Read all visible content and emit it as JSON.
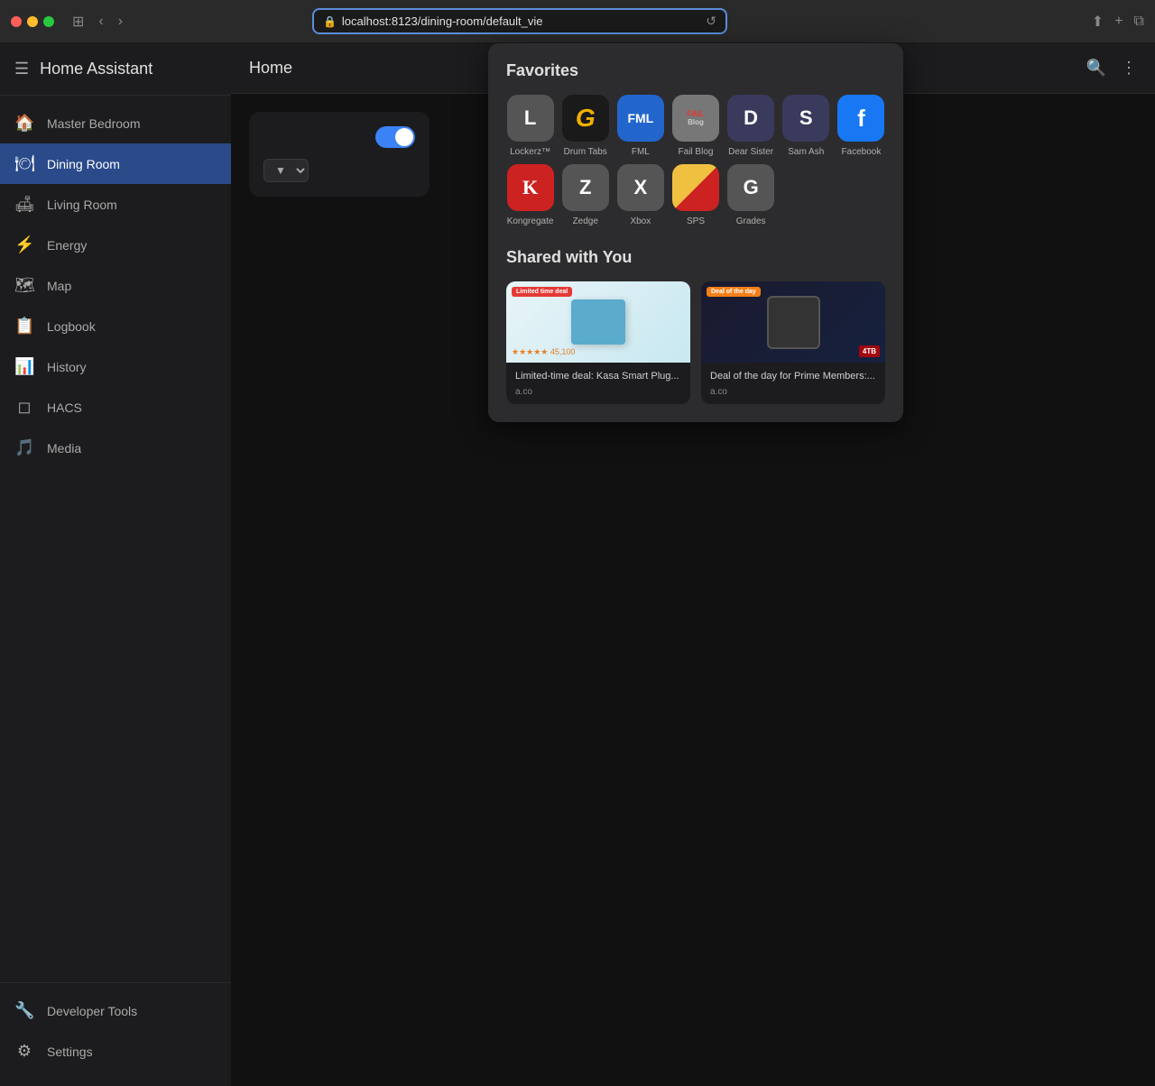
{
  "browser": {
    "url": "localhost:8123/dining-room/default_vie",
    "reload_icon": "↺"
  },
  "app": {
    "title": "Home Assistant",
    "page_title": "Home"
  },
  "sidebar": {
    "items": [
      {
        "id": "master-bedroom",
        "label": "Master Bedroom",
        "icon": "house"
      },
      {
        "id": "dining-room",
        "label": "Dining Room",
        "icon": "dining",
        "active": true
      },
      {
        "id": "living-room",
        "label": "Living Room",
        "icon": "sofa"
      },
      {
        "id": "energy",
        "label": "Energy",
        "icon": "bolt"
      },
      {
        "id": "map",
        "label": "Map",
        "icon": "map"
      },
      {
        "id": "logbook",
        "label": "Logbook",
        "icon": "list"
      },
      {
        "id": "history",
        "label": "History",
        "icon": "chart"
      },
      {
        "id": "hacs",
        "label": "HACS",
        "icon": "hacs"
      },
      {
        "id": "media",
        "label": "Media",
        "icon": "media"
      }
    ],
    "footer_items": [
      {
        "id": "developer-tools",
        "label": "Developer Tools",
        "icon": "wrench"
      },
      {
        "id": "settings",
        "label": "Settings",
        "icon": "gear"
      }
    ]
  },
  "safari_dropdown": {
    "favorites_title": "Favorites",
    "favorites": [
      {
        "id": "lockerz",
        "label": "Lockerz™",
        "letter": "L",
        "bg": "#555555"
      },
      {
        "id": "drum-tabs",
        "label": "Drum Tabs",
        "letter": "G",
        "bg": "#1a1a1a",
        "special": "drumtabs"
      },
      {
        "id": "fml",
        "label": "FML",
        "letter": "FML",
        "bg": "#3b7dd8",
        "special": "fml"
      },
      {
        "id": "fail-blog",
        "label": "Fail Blog",
        "letter": "FAIL",
        "bg": "#888888",
        "special": "failblog"
      },
      {
        "id": "dear-sister",
        "label": "Dear Sister",
        "letter": "D",
        "bg": "#2a2a4a"
      },
      {
        "id": "sam-ash",
        "label": "Sam Ash",
        "letter": "S",
        "bg": "#2a2a4a"
      },
      {
        "id": "facebook",
        "label": "Facebook",
        "letter": "f",
        "bg": "#1877f2",
        "special": "facebook"
      },
      {
        "id": "kongregate",
        "label": "Kongregate",
        "letter": "K",
        "bg": "#cc2222",
        "special": "kongregate"
      },
      {
        "id": "zedge",
        "label": "Zedge",
        "letter": "Z",
        "bg": "#555555"
      },
      {
        "id": "xbox",
        "label": "Xbox",
        "letter": "X",
        "bg": "#555555"
      },
      {
        "id": "sps",
        "label": "SPS",
        "letter": "",
        "bg": "#f0c040",
        "special": "sps"
      },
      {
        "id": "grades",
        "label": "Grades",
        "letter": "G",
        "bg": "#555555"
      }
    ],
    "shared_title": "Shared with You",
    "shared_items": [
      {
        "id": "kasa",
        "title": "Limited-time deal: Kasa Smart Plug...",
        "domain": "a.co",
        "badge": "Limited time deal",
        "type": "kasa"
      },
      {
        "id": "ironwolf",
        "title": "Deal of the day for Prime Members:...",
        "domain": "a.co",
        "badge": "Deal of the day",
        "type": "ironwolf"
      }
    ]
  }
}
